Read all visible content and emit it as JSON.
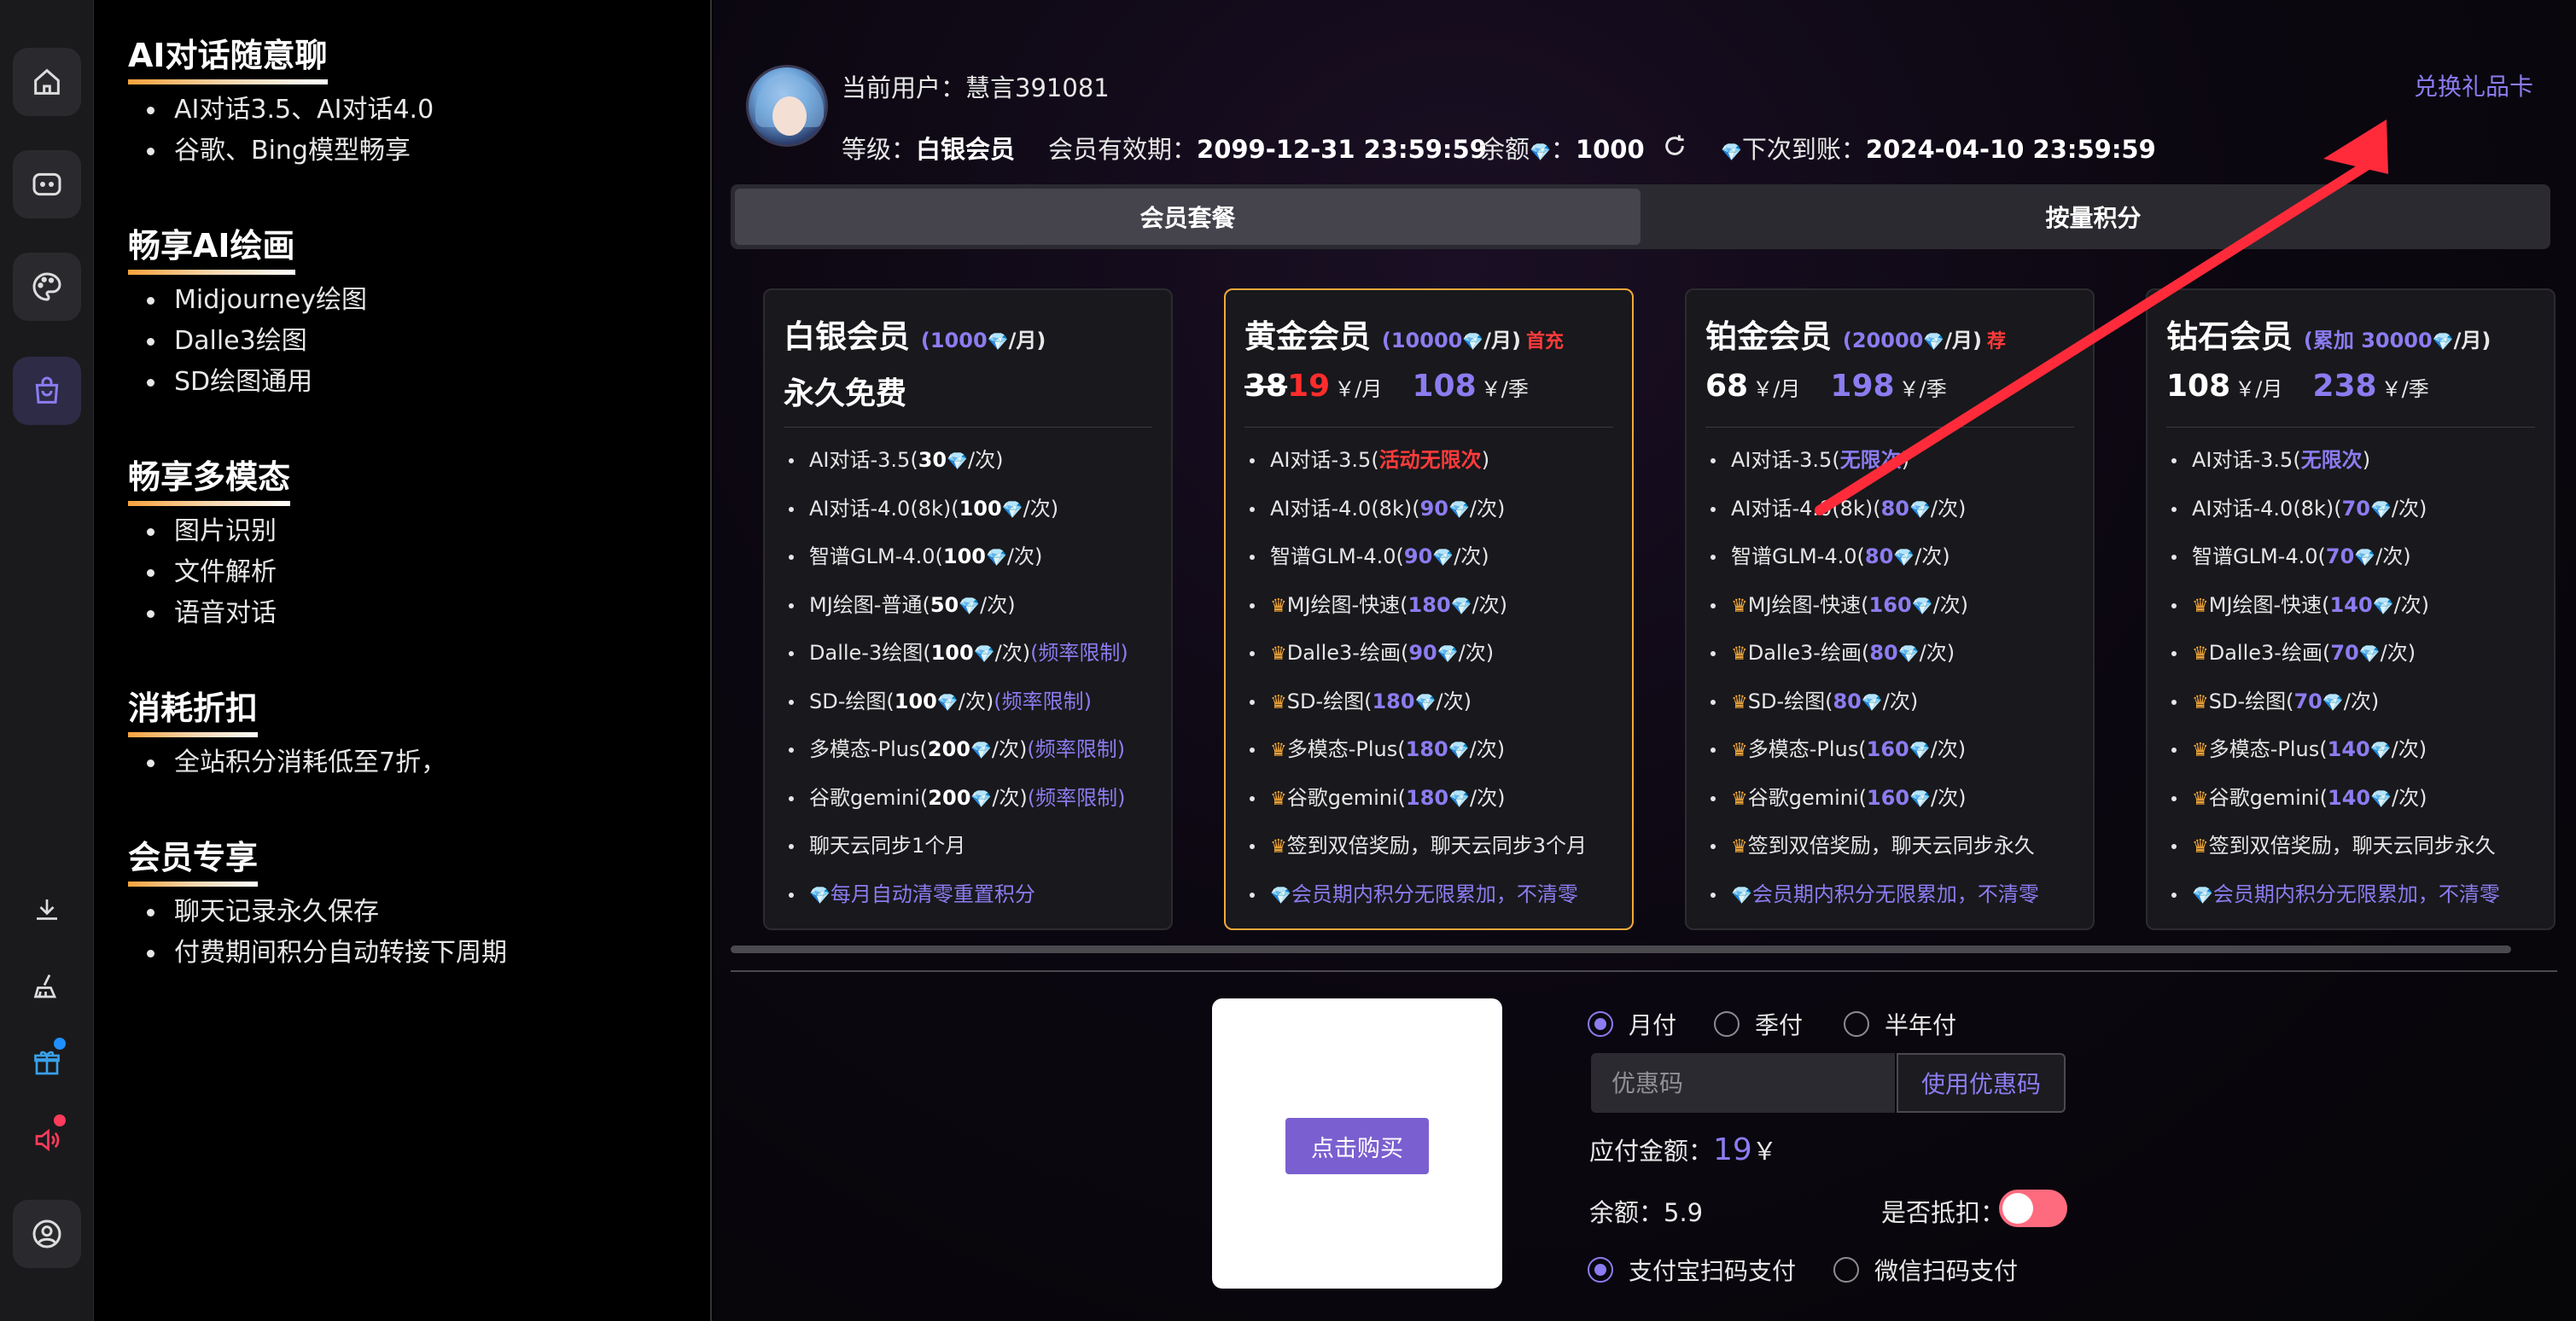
{
  "features": [
    {
      "title": "AI对话随意聊",
      "items": [
        "AI对话3.5、AI对话4.0",
        "谷歌、Bing模型畅享"
      ]
    },
    {
      "title": "畅享AI绘画",
      "items": [
        "Midjourney绘图",
        "Dalle3绘图",
        "SD绘图通用"
      ]
    },
    {
      "title": "畅享多模态",
      "items": [
        "图片识别",
        "文件解析",
        "语音对话"
      ]
    },
    {
      "title": "消耗折扣",
      "items": [
        "全站积分消耗低至7折，"
      ]
    },
    {
      "title": "会员专享",
      "items": [
        "聊天记录永久保存",
        "付费期间积分自动转接下周期"
      ]
    }
  ],
  "user": {
    "current_label": "当前用户：",
    "name": "慧言391081",
    "level_label": "等级：",
    "level": "白银会员",
    "expiry_label": "会员有效期：",
    "expiry": "2099-12-31 23:59:59",
    "balance_label": "余额",
    "balance": "1000",
    "next_label": "下次到账：",
    "next": "2024-04-10 23:59:59",
    "gift_link": "兑换礼品卡"
  },
  "tabs": [
    "会员套餐",
    "按量积分"
  ],
  "plans": [
    {
      "name": "白银会员",
      "per_pre": "(1000",
      "per_post": "/月)",
      "line2": "永久免费",
      "features": [
        {
          "pre": "AI对话-3.5(",
          "num": "30",
          "post": "/次)"
        },
        {
          "pre": "AI对话-4.0(8k)(",
          "num": "100",
          "post": "/次)"
        },
        {
          "pre": "智谱GLM-4.0(",
          "num": "100",
          "post": "/次)"
        },
        {
          "pre": "MJ绘图-普通(",
          "num": "50",
          "post": "/次)"
        },
        {
          "pre": "Dalle-3绘图(",
          "num": "100",
          "post": "/次)",
          "lim": "(频率限制)"
        },
        {
          "pre": "SD-绘图(",
          "num": "100",
          "post": "/次)",
          "lim": "(频率限制)"
        },
        {
          "pre": "多模态-Plus(",
          "num": "200",
          "post": "/次)",
          "lim": "(频率限制)"
        },
        {
          "pre": "谷歌gemini(",
          "num": "200",
          "post": "/次)",
          "lim": "(频率限制)"
        },
        {
          "pre": "聊天云同步1个月"
        },
        {
          "blue": "每月自动清零重置积分"
        }
      ]
    },
    {
      "name": "黄金会员",
      "per_pre": "(10000",
      "per_post": "/月)",
      "tag": "首充",
      "old_price": "38",
      "price": "19",
      "unit1": "￥/月",
      "price2": "108",
      "unit2": "￥/季",
      "features": [
        {
          "pre": "AI对话-3.5(",
          "red": "活动无限次",
          "post": ")"
        },
        {
          "pre": "AI对话-4.0(8k)(",
          "pnum": "90",
          "post": "/次)"
        },
        {
          "pre": "智谱GLM-4.0(",
          "pnum": "90",
          "post": "/次)"
        },
        {
          "crown": true,
          "pre": "MJ绘图-快速(",
          "pnum": "180",
          "post": "/次)"
        },
        {
          "crown": true,
          "pre": "Dalle3-绘画(",
          "pnum": "90",
          "post": "/次)"
        },
        {
          "crown": true,
          "pre": "SD-绘图(",
          "pnum": "180",
          "post": "/次)"
        },
        {
          "crown": true,
          "pre": "多模态-Plus(",
          "pnum": "180",
          "post": "/次)"
        },
        {
          "crown": true,
          "pre": "谷歌gemini(",
          "pnum": "180",
          "post": "/次)"
        },
        {
          "crown": true,
          "pre": "签到双倍奖励，聊天云同步3个月"
        },
        {
          "blue": "会员期内积分无限累加，不清零"
        }
      ]
    },
    {
      "name": "铂金会员",
      "per_pre": "(20000",
      "per_post": "/月)",
      "tag": "荐",
      "price": "68",
      "unit1": "￥/月",
      "price2": "198",
      "unit2": "￥/季",
      "features": [
        {
          "pre": "AI对话-3.5(",
          "pnum": "无限次",
          "post": ")"
        },
        {
          "pre": "AI对话-4.0(8k)(",
          "pnum": "80",
          "post": "/次)"
        },
        {
          "pre": "智谱GLM-4.0(",
          "pnum": "80",
          "post": "/次)"
        },
        {
          "crown": true,
          "pre": "MJ绘图-快速(",
          "pnum": "160",
          "post": "/次)"
        },
        {
          "crown": true,
          "pre": "Dalle3-绘画(",
          "pnum": "80",
          "post": "/次)"
        },
        {
          "crown": true,
          "pre": "SD-绘图(",
          "pnum": "80",
          "post": "/次)"
        },
        {
          "crown": true,
          "pre": "多模态-Plus(",
          "pnum": "160",
          "post": "/次)"
        },
        {
          "crown": true,
          "pre": "谷歌gemini(",
          "pnum": "160",
          "post": "/次)"
        },
        {
          "crown": true,
          "pre": "签到双倍奖励，聊天云同步永久"
        },
        {
          "blue": "会员期内积分无限累加，不清零"
        }
      ]
    },
    {
      "name": "钻石会员",
      "per_pre": "(累加 30000",
      "per_post": "/月)",
      "price": "108",
      "unit1": "￥/月",
      "price2": "238",
      "unit2": "￥/季",
      "features": [
        {
          "pre": "AI对话-3.5(",
          "pnum": "无限次",
          "post": ")"
        },
        {
          "pre": "AI对话-4.0(8k)(",
          "pnum": "70",
          "post": "/次)"
        },
        {
          "pre": "智谱GLM-4.0(",
          "pnum": "70",
          "post": "/次)"
        },
        {
          "crown": true,
          "pre": "MJ绘图-快速(",
          "pnum": "140",
          "post": "/次)"
        },
        {
          "crown": true,
          "pre": "Dalle3-绘画(",
          "pnum": "70",
          "post": "/次)"
        },
        {
          "crown": true,
          "pre": "SD-绘图(",
          "pnum": "70",
          "post": "/次)"
        },
        {
          "crown": true,
          "pre": "多模态-Plus(",
          "pnum": "140",
          "post": "/次)"
        },
        {
          "crown": true,
          "pre": "谷歌gemini(",
          "pnum": "140",
          "post": "/次)"
        },
        {
          "crown": true,
          "pre": "签到双倍奖励，聊天云同步永久"
        },
        {
          "blue": "会员期内积分无限累加，不清零"
        }
      ]
    }
  ],
  "payment": {
    "buy_label": "点击购买",
    "periods": [
      "月付",
      "季付",
      "半年付"
    ],
    "selected_period": "月付",
    "coupon_placeholder": "优惠码",
    "coupon_button": "使用优惠码",
    "amount_label": "应付金额：",
    "amount": "19",
    "amount_unit": "￥",
    "balance_label": "余额：",
    "balance": "5.9",
    "deduct_label": "是否抵扣：",
    "deduct_on": false,
    "methods": [
      "支付宝扫码支付",
      "微信扫码支付"
    ],
    "selected_method": "支付宝扫码支付"
  },
  "gem_glyph": "💎",
  "crown_glyph": "♛"
}
